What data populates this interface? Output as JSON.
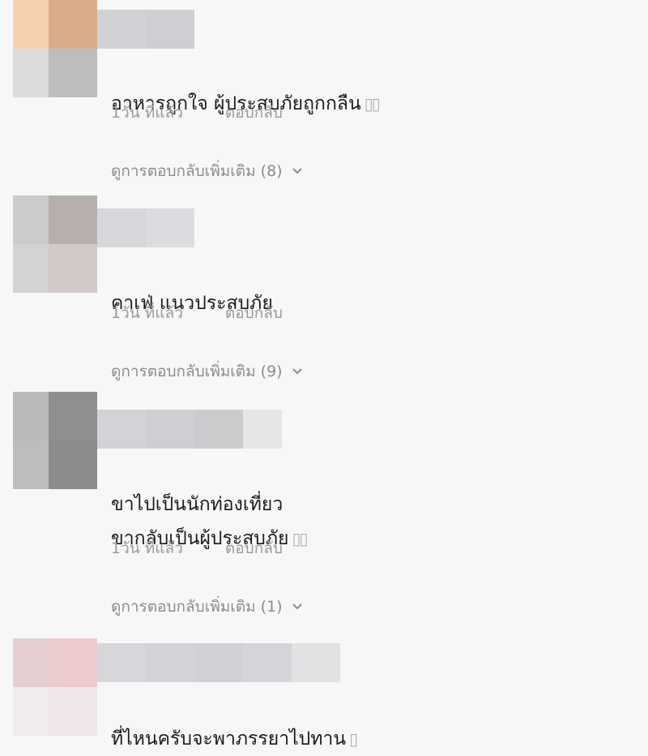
{
  "comments": [
    {
      "text": "อาหารถูกใจ ผู้ประสบภัยถูกกลืน",
      "emoji": "▯▯",
      "time": "1วัน ที่แล้ว",
      "reply": "ตอบกลับ",
      "more_replies": "ดูการตอบกลับเพิ่มเติม (8)",
      "avatar_colors": [
        "#f5d2ad",
        "#d9ad89",
        "#dcdcdc",
        "#bdbdbf"
      ],
      "name_colors": [
        "#d2d2d6",
        "#cfcfd3"
      ]
    },
    {
      "text": "คาเฟ่ แนวประสบภัย",
      "emoji": "",
      "time": "1วัน ที่แล้ว",
      "reply": "ตอบกลับ",
      "more_replies": "ดูการตอบกลับเพิ่มเติม (9)",
      "avatar_colors": [
        "#cbcbcb",
        "#b7aeae",
        "#d3d3d3",
        "#d3c9c8"
      ],
      "name_colors": [
        "#d7d7db",
        "#dcdce0"
      ]
    },
    {
      "text": "ขาไปเป็นนักท่องเที่ยว\nขากลับเป็นผู้ประสบภัย",
      "emoji": "▯▯",
      "time": "1วัน ที่แล้ว",
      "reply": "ตอบกลับ",
      "more_replies": "ดูการตอบกลับเพิ่มเติม (1)",
      "avatar_colors": [
        "#bababa",
        "#8f8f8f",
        "#bdbdbd",
        "#8c8c8c"
      ],
      "name_colors": [
        "#d3d3d7",
        "#cfcfd3",
        "#cccccf",
        "#e6e6e9"
      ]
    },
    {
      "text": "ที่ไหนครับจะพาภรรยาไปทาน",
      "emoji": "▯",
      "avatar_colors": [
        "#e4cfd3",
        "#ebcbce",
        "#f0ebec",
        "#eee6e8"
      ],
      "name_colors": [
        "#d7d7db",
        "#d3d3d7",
        "#d1d1d5",
        "#d5d5d9",
        "#e2e2e5"
      ]
    }
  ]
}
